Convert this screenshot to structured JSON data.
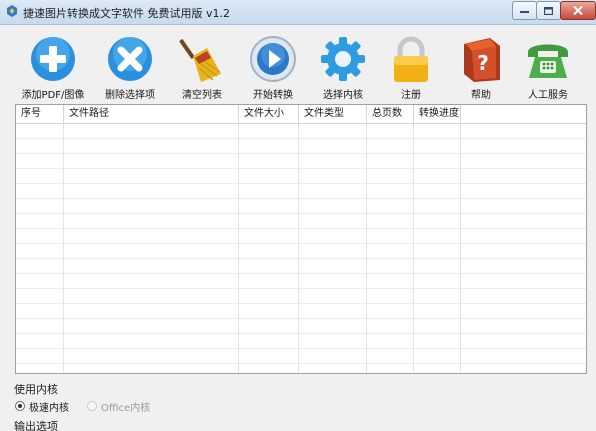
{
  "window": {
    "title": "捷速图片转换成文字软件 免费试用版 v1.2",
    "icons": {
      "app": "app-logo-icon",
      "minimize": "minimize-icon",
      "maximize": "maximize-icon",
      "close": "close-icon"
    }
  },
  "toolbar": {
    "add_pdf": {
      "label": "添加PDF/图像",
      "icon": "add-plus-icon"
    },
    "delete": {
      "label": "删除选择项",
      "icon": "delete-x-icon"
    },
    "clear": {
      "label": "清空列表",
      "icon": "broom-icon"
    },
    "start": {
      "label": "开始转换",
      "icon": "play-icon"
    },
    "engine": {
      "label": "选择内核",
      "icon": "gear-icon"
    },
    "register": {
      "label": "注册",
      "icon": "lock-icon"
    },
    "help": {
      "label": "帮助",
      "icon": "help-book-icon"
    },
    "service": {
      "label": "人工服务",
      "icon": "telephone-icon"
    }
  },
  "table": {
    "columns": [
      "序号",
      "文件路径",
      "文件大小",
      "文件类型",
      "总页数",
      "转换进度"
    ],
    "rows": []
  },
  "engine_group": {
    "title": "使用内核",
    "options": [
      {
        "label": "极速内核",
        "selected": true
      },
      {
        "label": "Office内核",
        "selected": false,
        "disabled": true
      }
    ]
  },
  "output_group": {
    "title": "输出选项"
  },
  "colors": {
    "accent_blue": "#1e8ad6",
    "title_bar": "#cfe0f1",
    "close_red": "#c7483a"
  }
}
